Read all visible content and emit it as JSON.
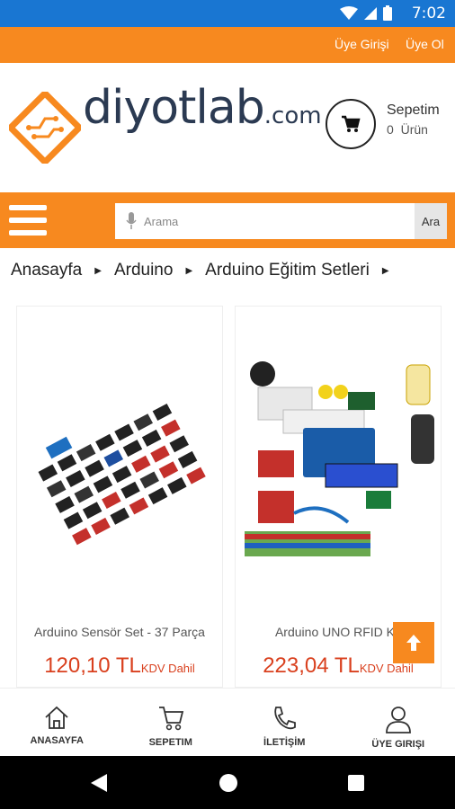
{
  "status_bar": {
    "time": "7:02",
    "icons": [
      "wifi-icon",
      "signal-icon",
      "battery-icon"
    ]
  },
  "top_bar": {
    "login": "Üye Girişi",
    "register": "Üye Ol"
  },
  "header": {
    "logo": {
      "brand": "diyotlab",
      "suffix": ".com"
    },
    "cart": {
      "title": "Sepetim",
      "count": "0",
      "unit": "Ürün"
    }
  },
  "search": {
    "placeholder": "Arama",
    "button": "Ara"
  },
  "breadcrumb": [
    "Anasayfa",
    "Arduino",
    "Arduino Eğitim Setleri"
  ],
  "products": [
    {
      "name": "Arduino Sensör Set - 37 Parça",
      "price": "120,10 TL",
      "tax": "KDV Dahil"
    },
    {
      "name": "Arduino UNO RFID Kit",
      "price": "223,04 TL",
      "tax": "KDV Dahil"
    }
  ],
  "bottom_nav": [
    {
      "label": "ANASAYFA",
      "icon": "home-icon"
    },
    {
      "label": "SEPETIM",
      "icon": "cart-icon"
    },
    {
      "label": "İLETİŞİM",
      "icon": "phone-icon"
    },
    {
      "label": "ÜYE GIRIŞI",
      "icon": "user-icon"
    }
  ],
  "colors": {
    "accent": "#f7891f",
    "status_bar": "#1976d2",
    "price": "#d9401e",
    "logo_text": "#2b3a52"
  }
}
